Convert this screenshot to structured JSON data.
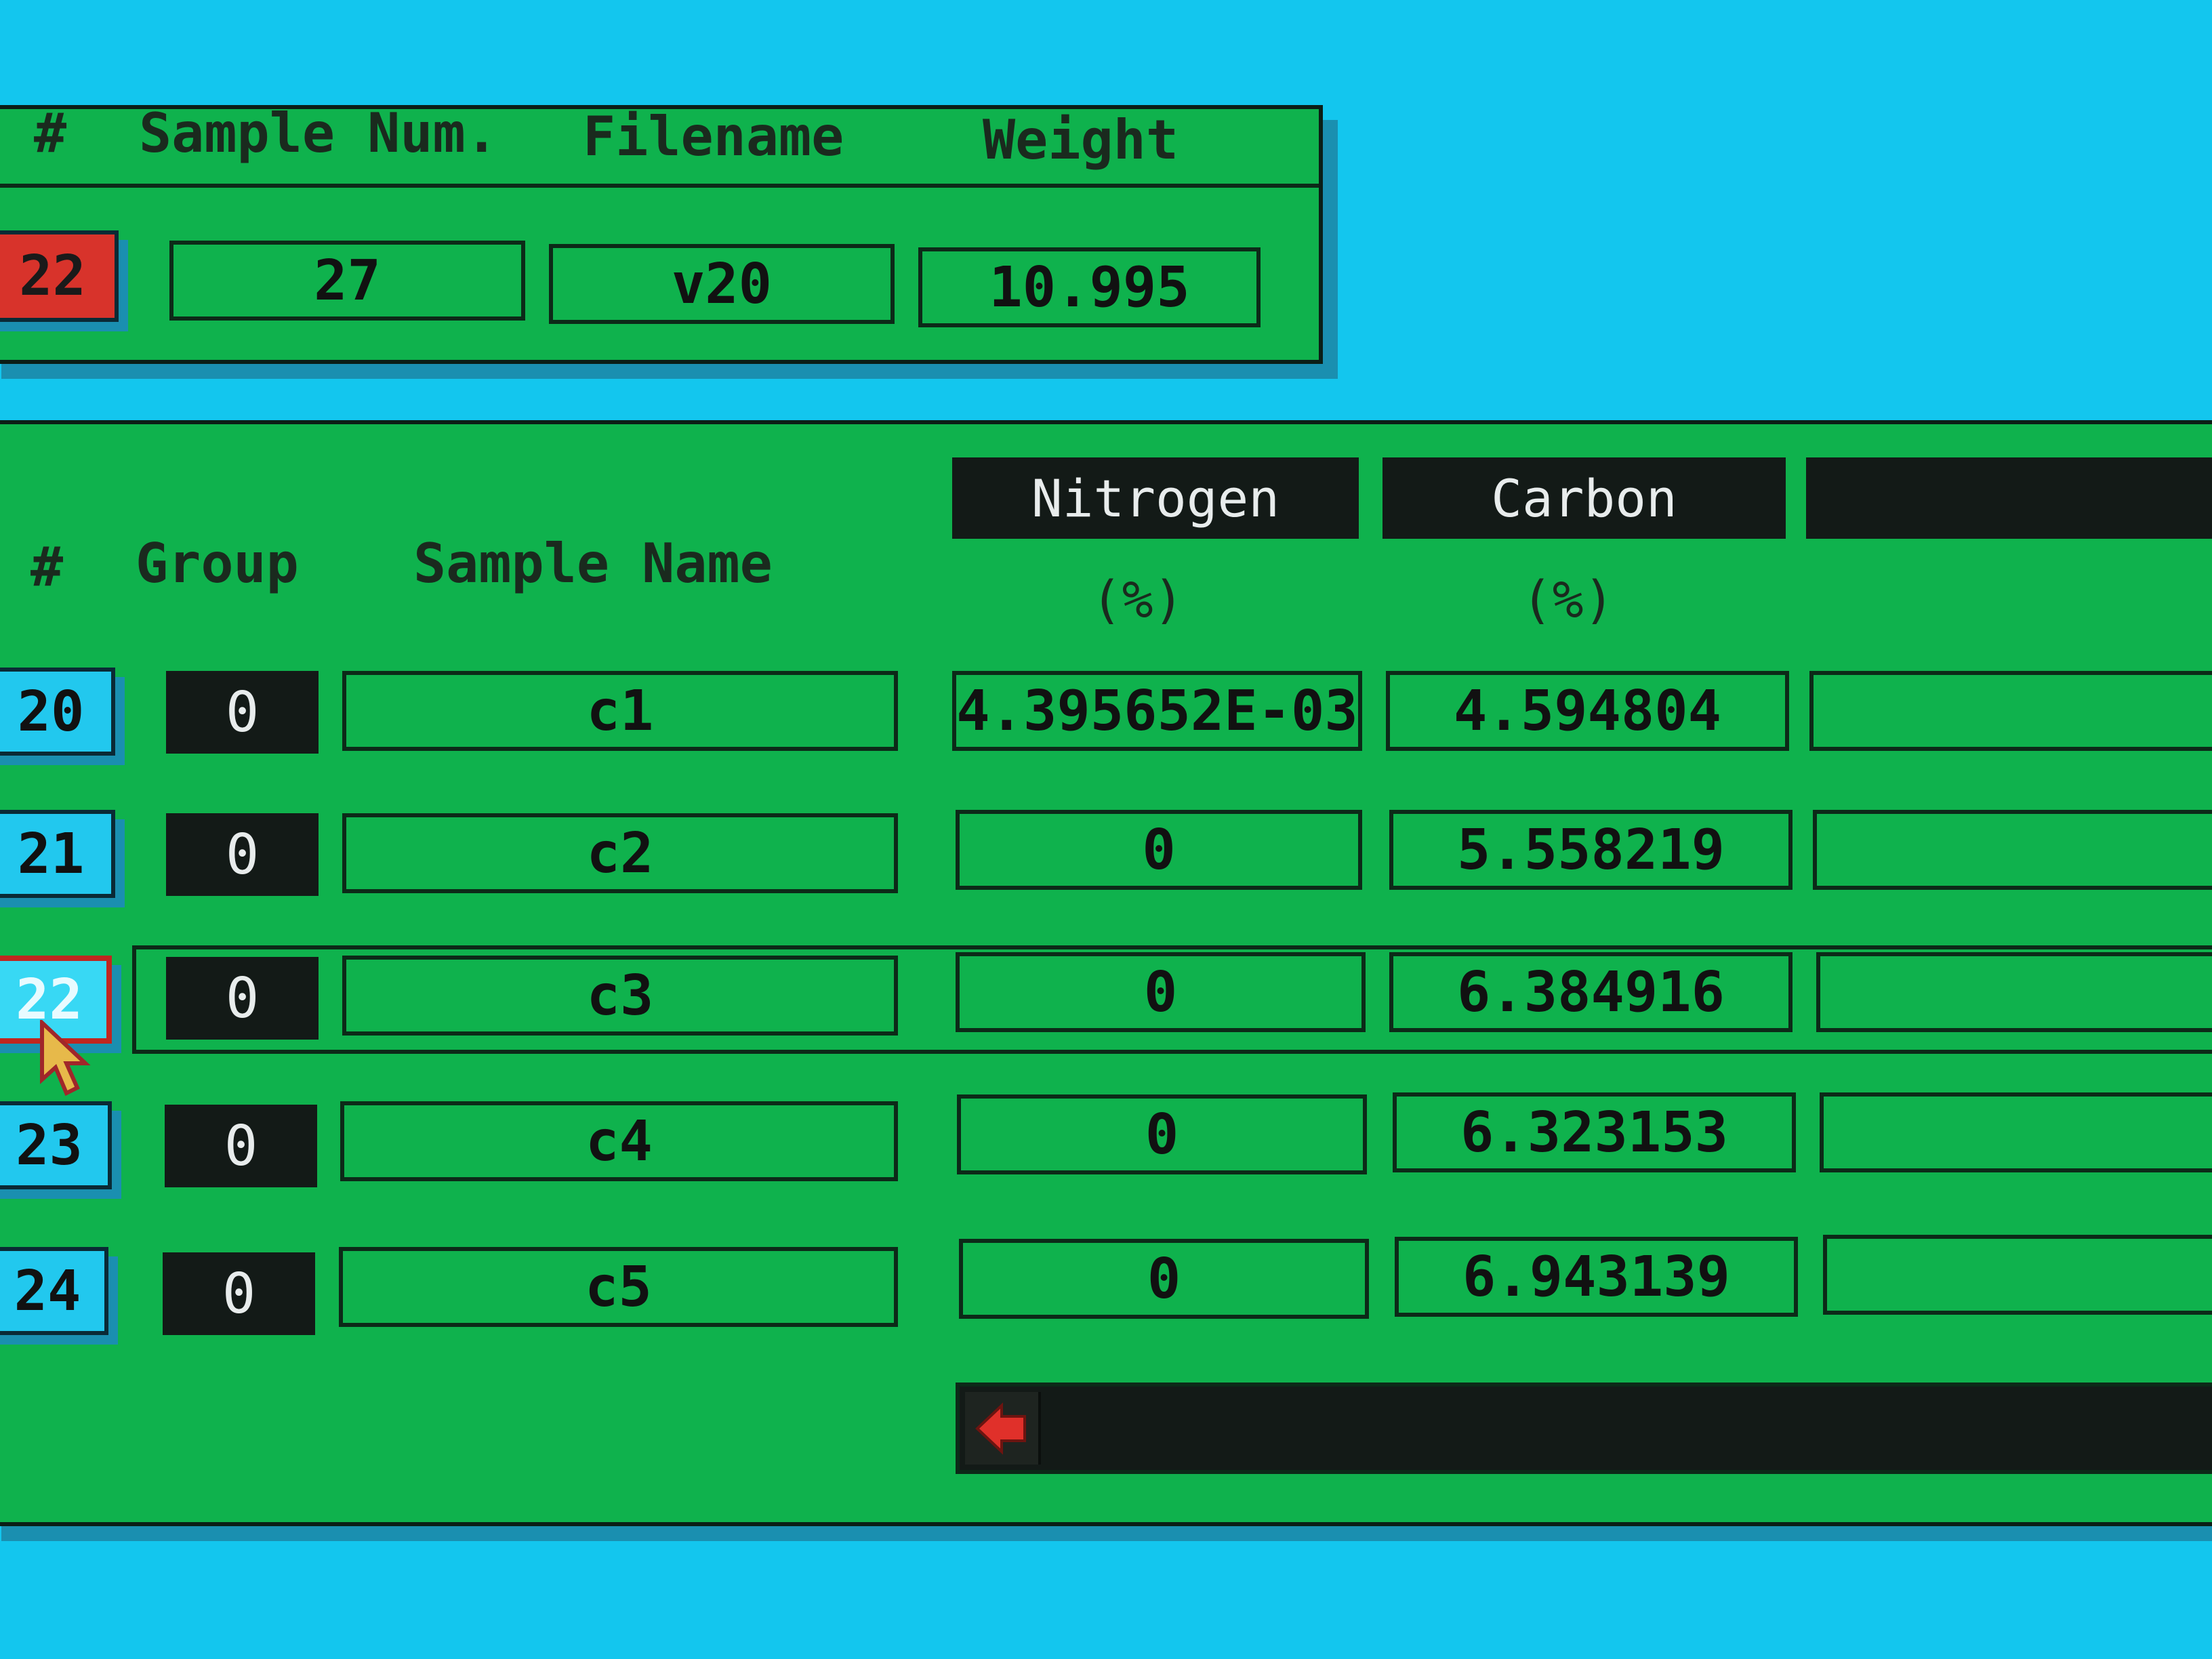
{
  "top_panel": {
    "headers": {
      "index": "#",
      "sample_num": "Sample Num.",
      "filename": "Filename",
      "weight": "Weight"
    },
    "current": {
      "index": "22",
      "sample_num": "27",
      "filename": "v20",
      "weight": "10.995"
    }
  },
  "table": {
    "headers": {
      "index": "#",
      "group": "Group",
      "sample_name": "Sample Name",
      "nitrogen": "Nitrogen",
      "nitrogen_unit": "(%)",
      "carbon": "Carbon",
      "carbon_unit": "(%)",
      "third": ""
    },
    "rows": [
      {
        "index": "20",
        "group": "0",
        "name": "c1",
        "nitrogen": "4.395652E-03",
        "carbon": "4.594804",
        "third": ""
      },
      {
        "index": "21",
        "group": "0",
        "name": "c2",
        "nitrogen": "0",
        "carbon": "5.558219",
        "third": ""
      },
      {
        "index": "22",
        "group": "0",
        "name": "c3",
        "nitrogen": "0",
        "carbon": "6.384916",
        "third": ""
      },
      {
        "index": "23",
        "group": "0",
        "name": "c4",
        "nitrogen": "0",
        "carbon": "6.323153",
        "third": ""
      },
      {
        "index": "24",
        "group": "0",
        "name": "c5",
        "nitrogen": "0",
        "carbon": "6.943139",
        "third": ""
      }
    ],
    "selected_row": 2
  },
  "scrollbar": {
    "left_arrow_icon": "left-arrow-icon"
  },
  "colors": {
    "panel": "#0fb24d",
    "background": "#13c6ee",
    "index_cyan": "#22c8ee",
    "index_red": "#d8332b",
    "dark": "#131a17"
  }
}
